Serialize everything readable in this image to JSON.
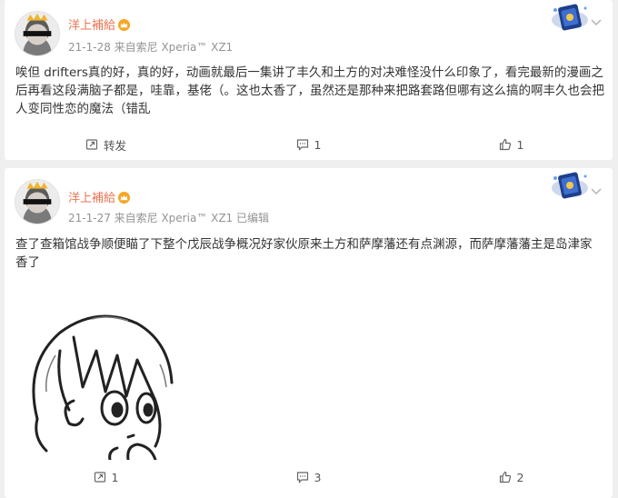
{
  "posts": [
    {
      "user": {
        "name": "洋上補給"
      },
      "meta": "21-1-28   来自索尼 Xperia™ XZ1",
      "content": "唉但 drifters真的好，真的好，动画就最后一集讲了丰久和土方的对决难怪没什么印象了，看完最新的漫画之后再看这段满脑子都是，哇靠，基佬（。这也太香了，虽然还是那种来把路套路但哪有这么搞的啊丰久也会把人变同性恋的魔法（错乱",
      "actions": {
        "repost": "转发",
        "comment": "1",
        "like": "1"
      }
    },
    {
      "user": {
        "name": "洋上補給"
      },
      "meta": "21-1-27   来自索尼 Xperia™ XZ1 已编辑",
      "content": "查了查箱馆战争顺便瞄了下整个戊辰战争概况好家伙原来土方和萨摩藩还有点渊源，而萨摩藩藩主是岛津家\n香了",
      "actions": {
        "repost": "1",
        "comment": "3",
        "like": "2"
      }
    }
  ],
  "icons": {
    "repost": "repost-icon",
    "comment": "comment-icon",
    "like": "like-icon",
    "menu": "chevron-down-icon",
    "vip": "crown-icon"
  },
  "colors": {
    "username": "#eb7350",
    "meta": "#939393",
    "text": "#333333",
    "background": "#efefef"
  }
}
